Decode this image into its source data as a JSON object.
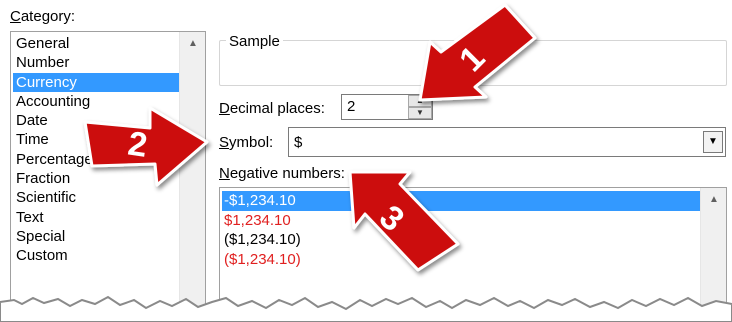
{
  "category": {
    "label_prefix": "C",
    "label_rest": "ategory:",
    "items": [
      "General",
      "Number",
      "Currency",
      "Accounting",
      "Date",
      "Time",
      "Percentage",
      "Fraction",
      "Scientific",
      "Text",
      "Special",
      "Custom"
    ],
    "selected": "Currency"
  },
  "sample": {
    "label": "Sample"
  },
  "decimal_places": {
    "label_prefix": "D",
    "label_rest": "ecimal places:",
    "value": "2"
  },
  "symbol": {
    "label_prefix": "S",
    "label_rest": "ymbol:",
    "value": "$"
  },
  "negative_numbers": {
    "label_prefix": "N",
    "label_rest": "egative numbers:",
    "items": [
      {
        "text": "-$1,234.10",
        "color": "black",
        "selected": true
      },
      {
        "text": "$1,234.10",
        "color": "red",
        "selected": false
      },
      {
        "text": "($1,234.10)",
        "color": "black",
        "selected": false
      },
      {
        "text": "($1,234.10)",
        "color": "red",
        "selected": false
      }
    ]
  },
  "callouts": [
    {
      "number": "1",
      "color": "#cc1111"
    },
    {
      "number": "2",
      "color": "#cc1111"
    },
    {
      "number": "3",
      "color": "#cc1111"
    }
  ],
  "colors": {
    "selection": "#3399ff",
    "negative_red": "#e02020",
    "arrow_red": "#cc1111"
  }
}
